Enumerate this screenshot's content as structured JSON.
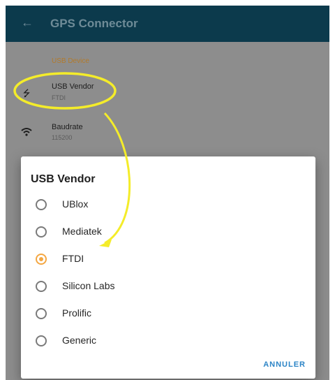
{
  "appbar": {
    "title": "GPS Connector",
    "back_icon": "arrow-left-icon"
  },
  "settings": {
    "section_title": "USB Device",
    "rows": [
      {
        "title": "USB Vendor",
        "subtitle": "FTDI",
        "icon": "usb-icon"
      },
      {
        "title": "Baudrate",
        "subtitle": "115200",
        "icon": "wifi-signal-icon"
      }
    ]
  },
  "dialog": {
    "title": "USB Vendor",
    "options": [
      {
        "label": "UBlox",
        "selected": false
      },
      {
        "label": "Mediatek",
        "selected": false
      },
      {
        "label": "FTDI",
        "selected": true
      },
      {
        "label": "Silicon Labs",
        "selected": false
      },
      {
        "label": "Prolific",
        "selected": false
      },
      {
        "label": "Generic",
        "selected": false
      }
    ],
    "cancel_label": "ANNULER"
  },
  "colors": {
    "accent": "#f4a742",
    "appbar": "#0c3a4c",
    "annotation": "#f4ec2a",
    "cancel": "#2b84c6"
  }
}
